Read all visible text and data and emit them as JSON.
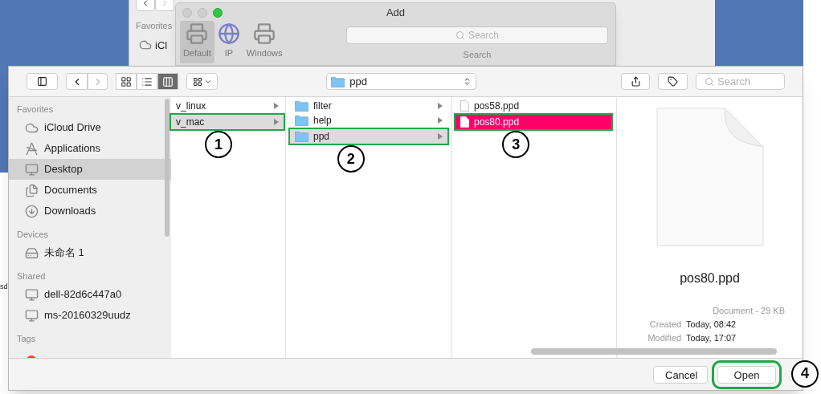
{
  "back_finder": {
    "section": "Favorites",
    "item": "iCl",
    "desktop_text": "sd"
  },
  "add_window": {
    "title": "Add",
    "tools": [
      {
        "label": "Default",
        "kind": "default",
        "selected": true
      },
      {
        "label": "IP",
        "kind": "ip",
        "selected": false
      },
      {
        "label": "Windows",
        "kind": "windows",
        "selected": false
      }
    ],
    "search": {
      "placeholder": "Search",
      "label": "Search"
    }
  },
  "toolbar": {
    "view_modes": [
      {
        "kind": "icons",
        "selected": false
      },
      {
        "kind": "list",
        "selected": false
      },
      {
        "kind": "columns",
        "selected": true
      }
    ],
    "path": "ppd",
    "search_placeholder": "Search"
  },
  "sidebar": [
    {
      "title": "Favorites",
      "items": [
        {
          "label": "iCloud Drive",
          "kind": "cloud",
          "selected": false
        },
        {
          "label": "Applications",
          "kind": "apps",
          "selected": false
        },
        {
          "label": "Desktop",
          "kind": "desktop",
          "selected": true
        },
        {
          "label": "Documents",
          "kind": "documents",
          "selected": false
        },
        {
          "label": "Downloads",
          "kind": "downloads",
          "selected": false
        }
      ]
    },
    {
      "title": "Devices",
      "items": [
        {
          "label": "未命名 1",
          "kind": "disk",
          "selected": false
        }
      ]
    },
    {
      "title": "Shared",
      "items": [
        {
          "label": "dell-82d6c447a0",
          "kind": "computer",
          "selected": false
        },
        {
          "label": "ms-20160329uudz",
          "kind": "computer",
          "selected": false
        }
      ]
    },
    {
      "title": "Tags"
    }
  ],
  "columns": [
    {
      "focused": false,
      "items": [
        {
          "label": "v_linux",
          "kind": "plain",
          "selected": false
        },
        {
          "label": "v_mac",
          "kind": "plain",
          "selected": true,
          "annotation": "1"
        }
      ]
    },
    {
      "focused": false,
      "items": [
        {
          "label": "filter",
          "kind": "folder",
          "selected": false
        },
        {
          "label": "help",
          "kind": "folder",
          "selected": false
        },
        {
          "label": "ppd",
          "kind": "folder",
          "selected": true,
          "annotation": "2"
        }
      ]
    },
    {
      "focused": true,
      "items": [
        {
          "label": "pos58.ppd",
          "kind": "file",
          "selected": false
        },
        {
          "label": "pos80.ppd",
          "kind": "file",
          "selected": true,
          "annotation": "3"
        }
      ]
    }
  ],
  "preview": {
    "name": "pos80.ppd",
    "summary": "Document - 29 KB",
    "info": [
      {
        "label": "Created",
        "value": "Today, 08:42"
      },
      {
        "label": "Modified",
        "value": "Today, 17:07"
      }
    ]
  },
  "buttons": [
    {
      "label": "Cancel",
      "default": false
    },
    {
      "label": "Open",
      "default": false,
      "annotation": "4"
    }
  ]
}
